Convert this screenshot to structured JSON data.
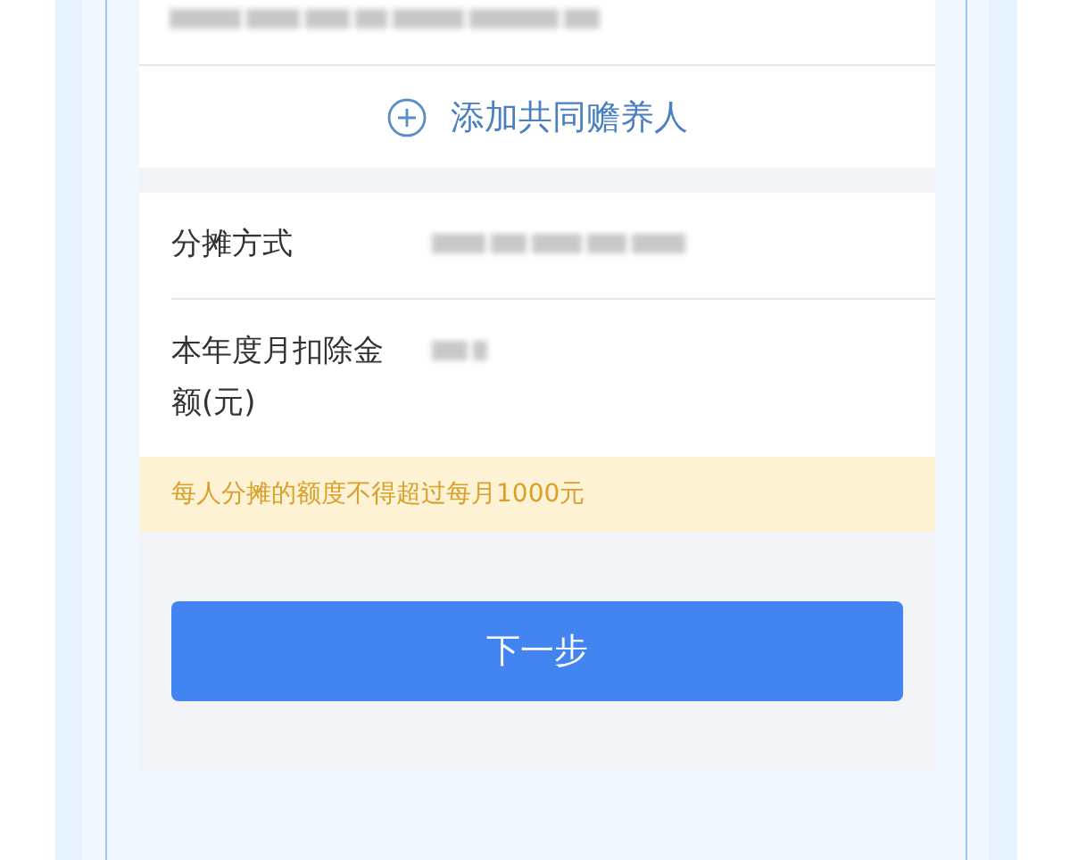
{
  "add_button": {
    "label": "添加共同赡养人"
  },
  "fields": [
    {
      "label": "分摊方式"
    },
    {
      "label": "本年度月扣除金额(元)"
    }
  ],
  "notice": "每人分摊的额度不得超过每月1000元",
  "next_button": {
    "label": "下一步"
  }
}
